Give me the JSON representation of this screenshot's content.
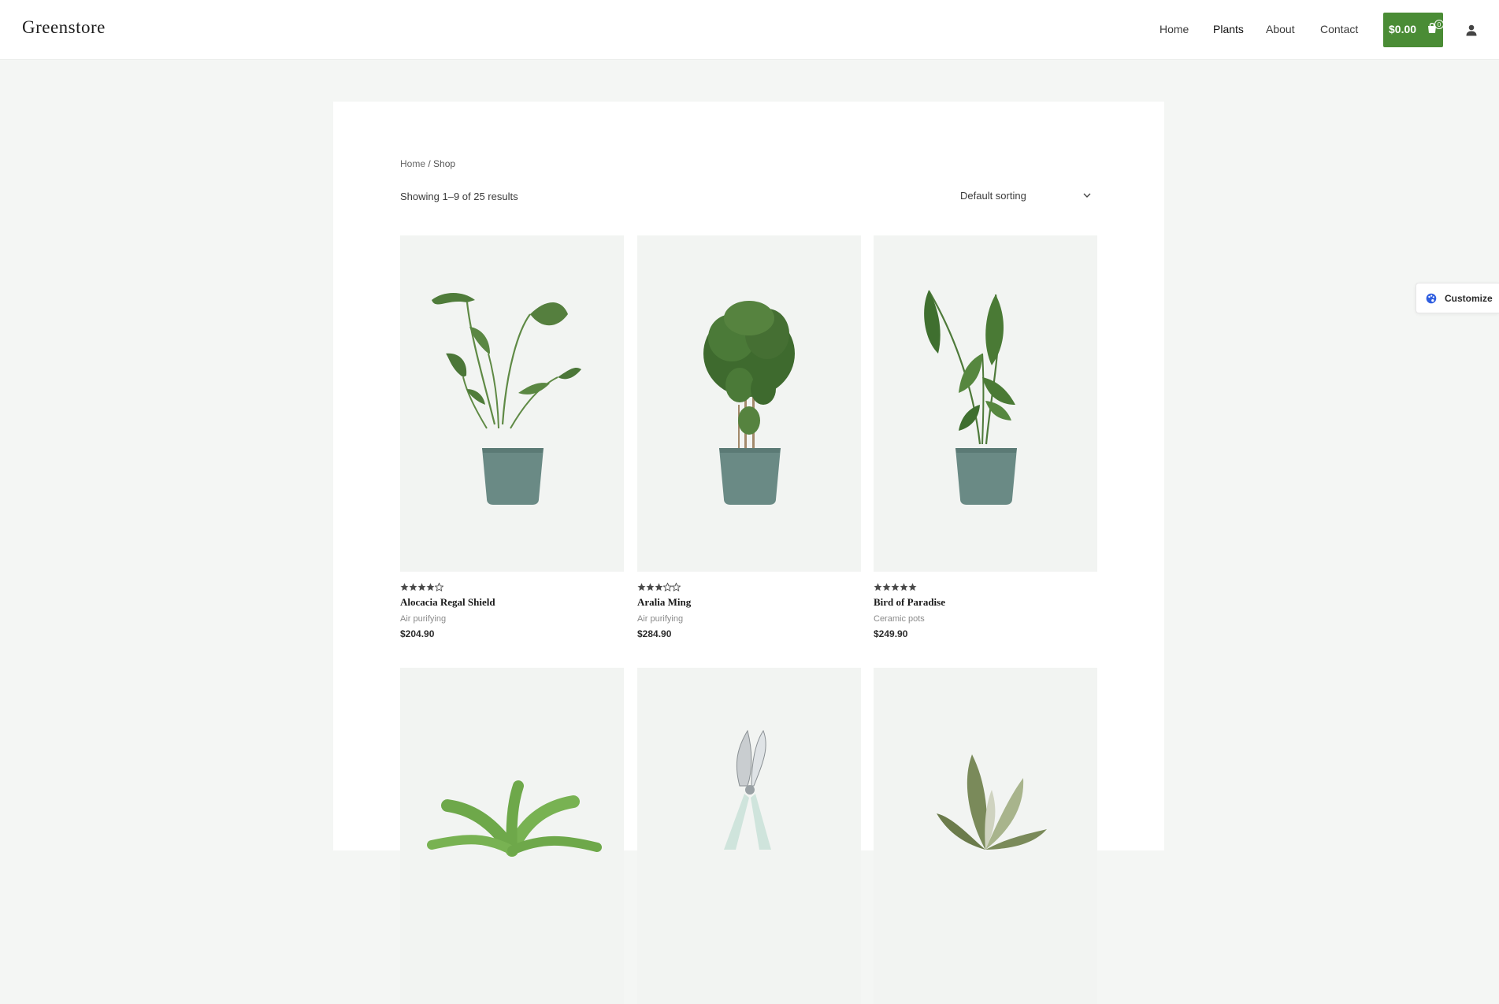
{
  "site": {
    "logo": "Greenstore"
  },
  "nav": {
    "items": [
      "Home",
      "Plants",
      "About",
      "Contact"
    ],
    "active": "Plants"
  },
  "cart": {
    "total": "$0.00",
    "count": "0",
    "icon": "shopping-bag-icon",
    "color": "#4a8c35"
  },
  "account": {
    "icon": "user-icon"
  },
  "breadcrumb": {
    "home": "Home",
    "sep": "/",
    "current": "Shop"
  },
  "shop": {
    "results_text": "Showing 1–9 of 25 results",
    "sorting": {
      "selected": "Default sorting",
      "icon": "chevron-down-icon"
    }
  },
  "products": [
    {
      "title": "Alocacia Regal Shield",
      "category": "Air purifying",
      "price": "$204.90",
      "rating": 4
    },
    {
      "title": "Aralia Ming",
      "category": "Air purifying",
      "price": "$284.90",
      "rating": 3
    },
    {
      "title": "Bird of Paradise",
      "category": "Ceramic pots",
      "price": "$249.90",
      "rating": 5
    },
    {
      "title": "",
      "category": "",
      "price": "",
      "rating": null
    },
    {
      "title": "",
      "category": "",
      "price": "",
      "rating": null
    },
    {
      "title": "",
      "category": "",
      "price": "",
      "rating": null
    }
  ],
  "customize": {
    "label": "Customize",
    "icon": "palette-icon"
  }
}
